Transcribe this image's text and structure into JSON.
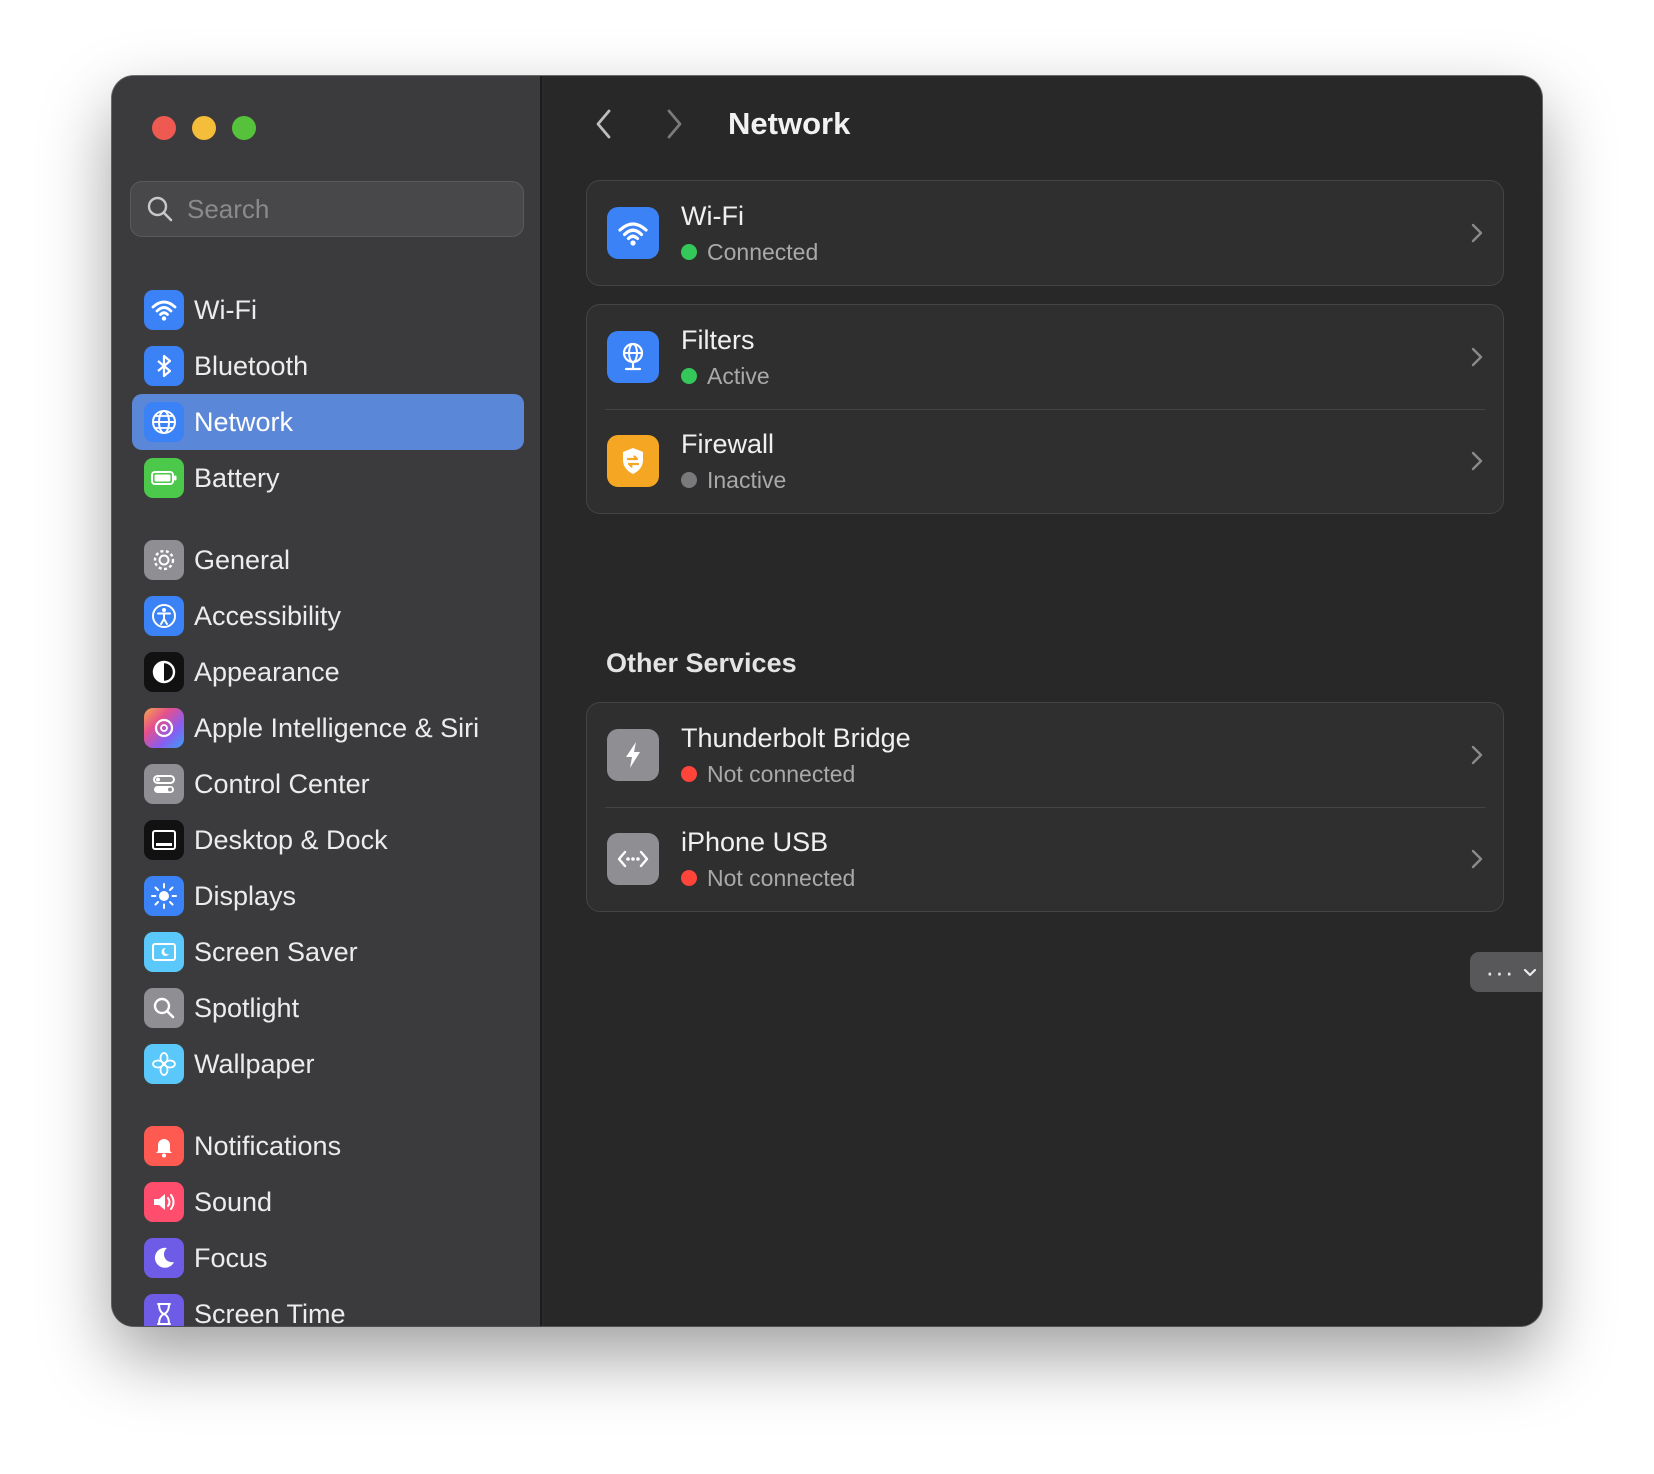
{
  "search": {
    "placeholder": "Search"
  },
  "sidebar": {
    "group1": [
      {
        "label": "Wi-Fi",
        "icon": "wifi-icon"
      },
      {
        "label": "Bluetooth",
        "icon": "bluetooth-icon"
      },
      {
        "label": "Network",
        "icon": "globe-icon",
        "active": true
      },
      {
        "label": "Battery",
        "icon": "battery-icon"
      }
    ],
    "group2": [
      {
        "label": "General",
        "icon": "gear-icon"
      },
      {
        "label": "Accessibility",
        "icon": "accessibility-icon"
      },
      {
        "label": "Appearance",
        "icon": "appearance-icon"
      },
      {
        "label": "Apple Intelligence & Siri",
        "icon": "siri-icon"
      },
      {
        "label": "Control Center",
        "icon": "toggles-icon"
      },
      {
        "label": "Desktop & Dock",
        "icon": "dock-icon"
      },
      {
        "label": "Displays",
        "icon": "sun-icon"
      },
      {
        "label": "Screen Saver",
        "icon": "screensaver-icon"
      },
      {
        "label": "Spotlight",
        "icon": "magnifier-icon"
      },
      {
        "label": "Wallpaper",
        "icon": "flower-icon"
      }
    ],
    "group3": [
      {
        "label": "Notifications",
        "icon": "bell-icon"
      },
      {
        "label": "Sound",
        "icon": "speaker-icon"
      },
      {
        "label": "Focus",
        "icon": "moon-icon"
      },
      {
        "label": "Screen Time",
        "icon": "hourglass-icon"
      }
    ]
  },
  "header": {
    "title": "Network"
  },
  "services": {
    "wifi": {
      "title": "Wi-Fi",
      "status": "Connected",
      "status_color": "#34c759"
    },
    "filters": {
      "title": "Filters",
      "status": "Active",
      "status_color": "#34c759"
    },
    "firewall": {
      "title": "Firewall",
      "status": "Inactive",
      "status_color": "#7a7a7c"
    }
  },
  "other_services": {
    "section_title": "Other Services",
    "thunderbolt": {
      "title": "Thunderbolt Bridge",
      "status": "Not connected",
      "status_color": "#ff453a"
    },
    "iphone_usb": {
      "title": "iPhone USB",
      "status": "Not connected",
      "status_color": "#ff453a"
    }
  },
  "footer": {
    "more_label": "···",
    "help_label": "?"
  },
  "colors": {
    "accent": "#5b87d8",
    "sidebar_bg": "#3b3b3d",
    "main_bg": "#282828"
  }
}
